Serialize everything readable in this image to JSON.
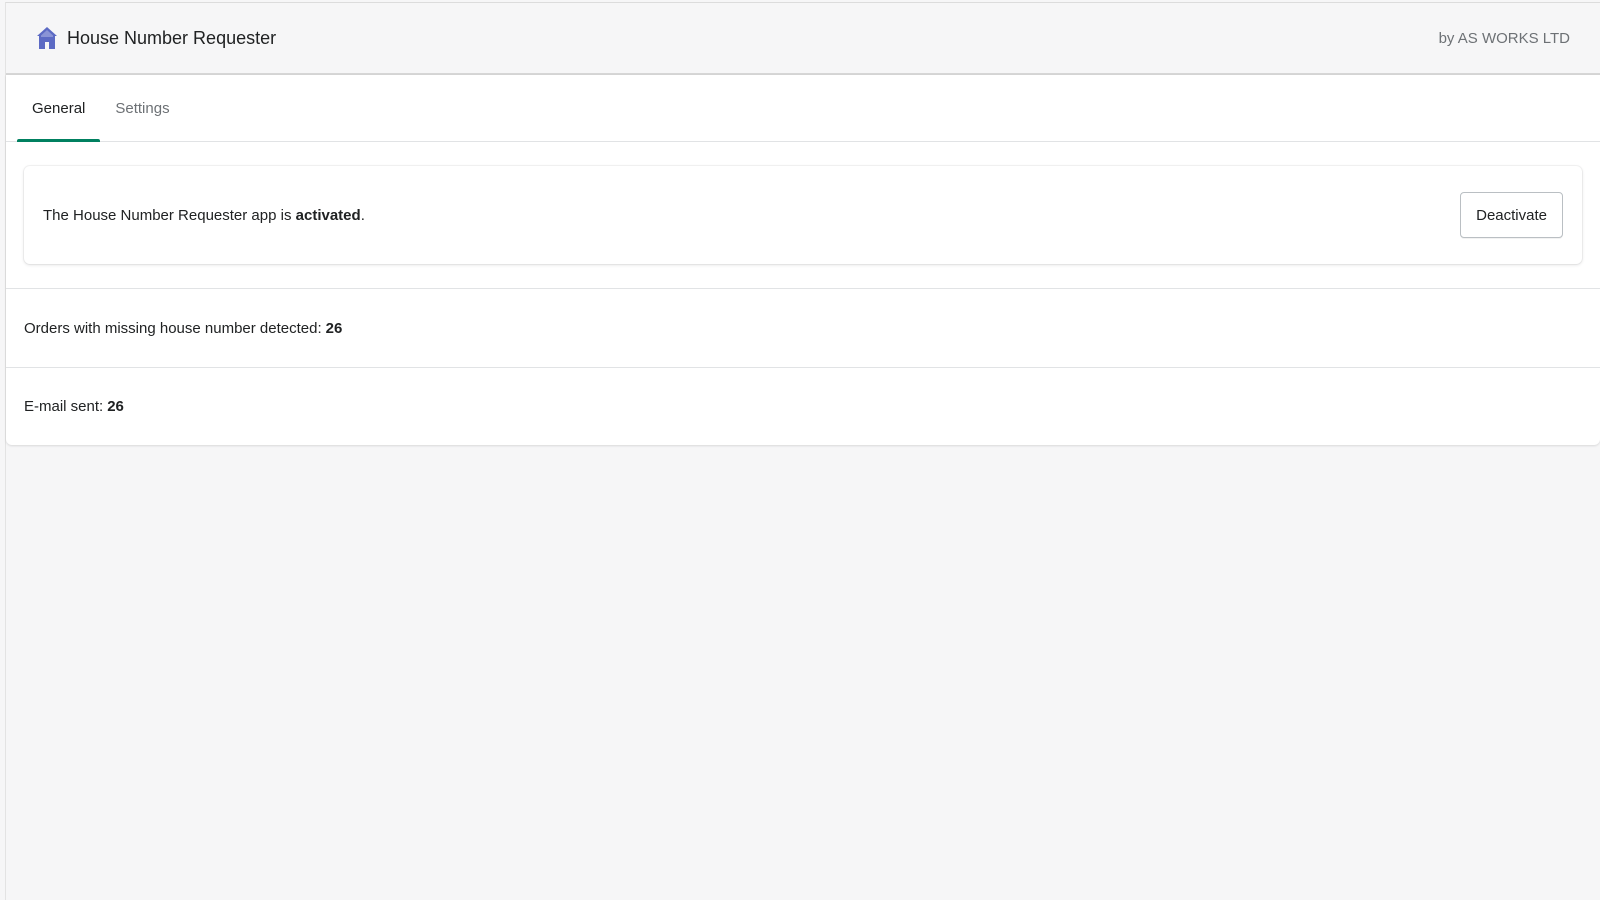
{
  "header": {
    "app_title": "House Number Requester",
    "vendor": "by AS WORKS LTD",
    "icon": "house-icon"
  },
  "tabs": [
    {
      "label": "General",
      "active": true
    },
    {
      "label": "Settings",
      "active": false
    }
  ],
  "status": {
    "text_prefix": "The House Number Requester app is",
    "state": "activated",
    "text_suffix": ".",
    "button_label": "Deactivate"
  },
  "stats": [
    {
      "label": "Orders with missing house number detected:",
      "value": "26"
    },
    {
      "label": "E-mail sent:",
      "value": "26"
    }
  ],
  "colors": {
    "accent": "#008060",
    "icon": "#5c6ac4"
  }
}
